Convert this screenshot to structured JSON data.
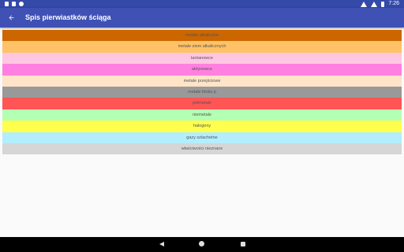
{
  "status_bar": {
    "time": "7:26"
  },
  "app_bar": {
    "title": "Spis pierwiastków ściąga",
    "background": "#3f51b5"
  },
  "categories": [
    {
      "label": "metale alkaliczne",
      "color": "#cc6600"
    },
    {
      "label": "metale ziem alkalicznych",
      "color": "#ffc266"
    },
    {
      "label": "lantanowce",
      "color": "#ffc6e2"
    },
    {
      "label": "aktynowce",
      "color": "#ff80e0"
    },
    {
      "label": "metale przejściowe",
      "color": "#ffe4c8"
    },
    {
      "label": "metale bloku p",
      "color": "#999999"
    },
    {
      "label": "półmetale",
      "color": "#ff5555"
    },
    {
      "label": "niemetale",
      "color": "#b3ffb3"
    },
    {
      "label": "halogeny",
      "color": "#ffff4d"
    },
    {
      "label": "gazy szlachetne",
      "color": "#b3eeff"
    },
    {
      "label": "właściwości nieznane",
      "color": "#d6d6d6"
    }
  ]
}
